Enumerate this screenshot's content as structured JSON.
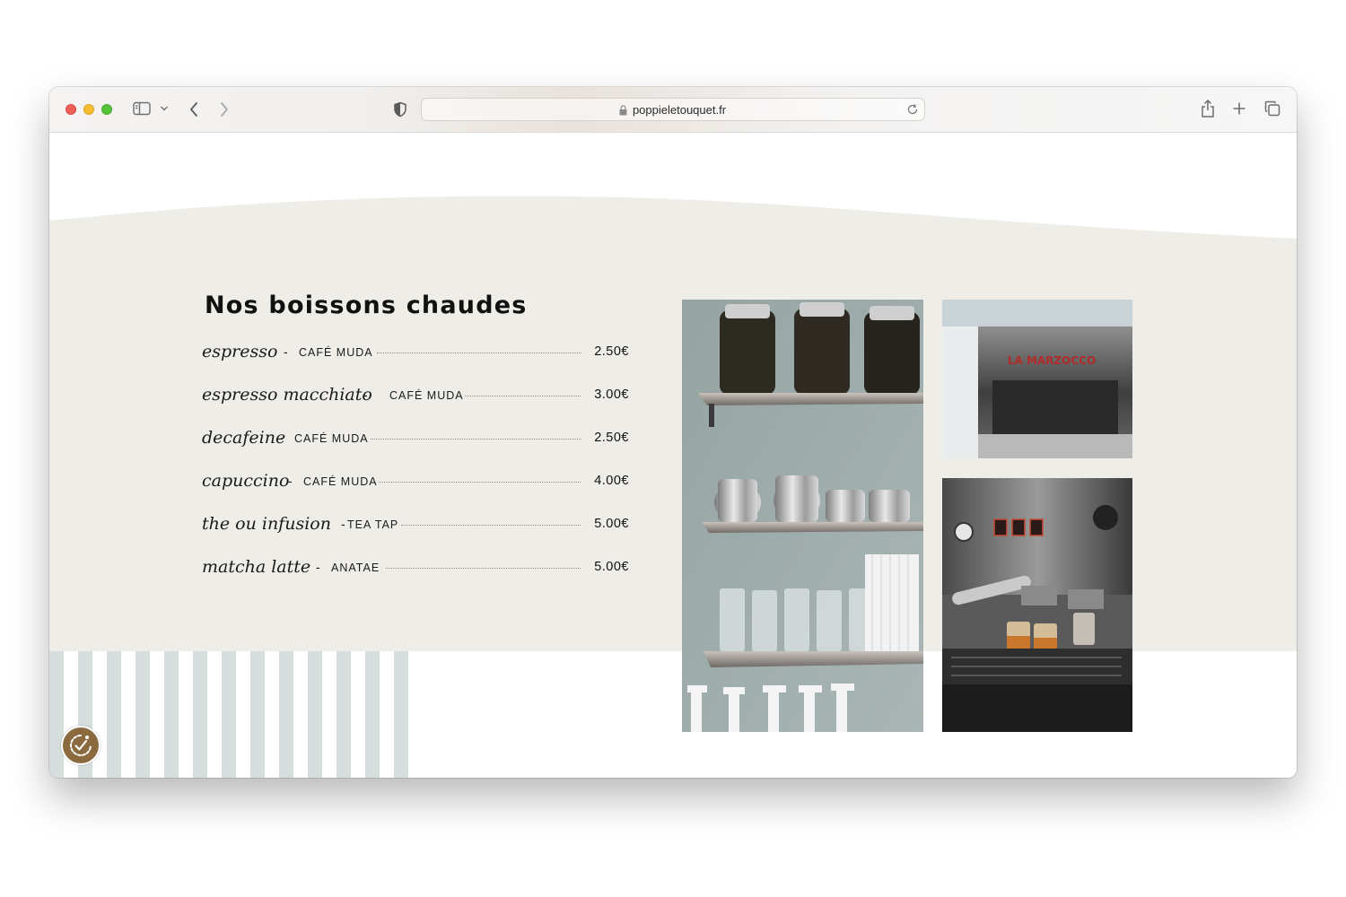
{
  "browser": {
    "url": "poppieletouquet.fr",
    "icons": [
      "sidebar-icon",
      "chevron-down-icon",
      "back-icon",
      "forward-icon",
      "shield-icon",
      "lock-icon",
      "reload-icon",
      "share-icon",
      "plus-icon",
      "tabs-icon"
    ]
  },
  "menu": {
    "title": "Nos boissons chaudes",
    "items": [
      {
        "name": "espresso",
        "brand": "CAFÉ MUDA",
        "price": "2.50€"
      },
      {
        "name": "espresso macchiato",
        "brand": "CAFÉ MUDA",
        "price": "3.00€"
      },
      {
        "name": "decafeine",
        "brand": "CAFÉ MUDA",
        "price": "2.50€"
      },
      {
        "name": "capuccino",
        "brand": "CAFÉ MUDA",
        "price": "4.00€"
      },
      {
        "name": "the ou infusion",
        "brand": "TEA TAP",
        "price": "5.00€"
      },
      {
        "name": "matcha latte",
        "brand": "ANATAE",
        "price": "5.00€"
      }
    ]
  },
  "photos": {
    "machine_brand": "LA MARZOCCO"
  },
  "colors": {
    "beige": "#efede7",
    "stripe": "#d6dddd",
    "badge": "#8b6a3f"
  }
}
